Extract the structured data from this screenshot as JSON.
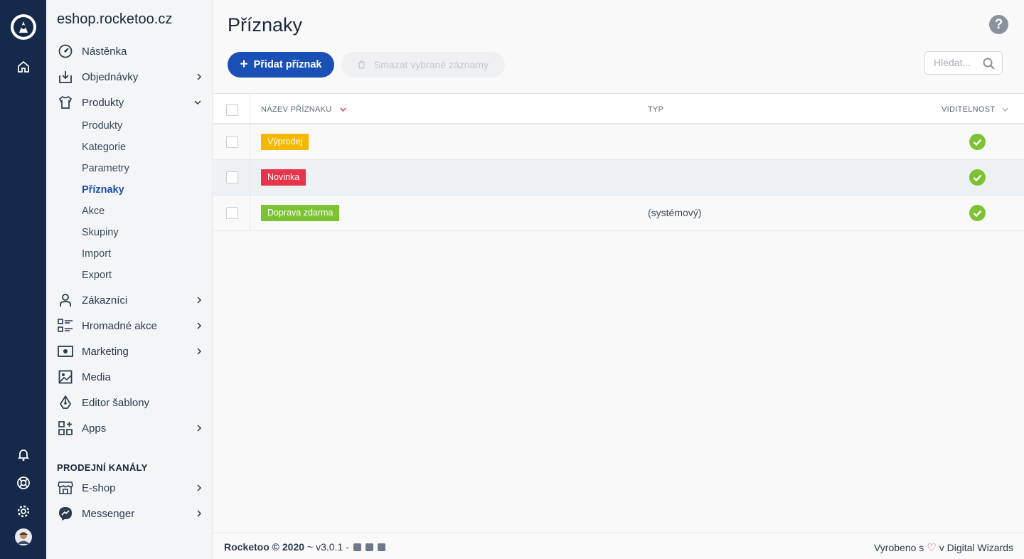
{
  "rail": {
    "icons": [
      "rocketoo-logo-icon",
      "home-icon",
      "bell-icon",
      "lifebuoy-icon",
      "gear-icon",
      "avatar"
    ]
  },
  "sidebar": {
    "shop_name": "eshop.rocketoo.cz",
    "items": [
      {
        "label": "Nástěnka",
        "icon": "dashboard-icon",
        "has_chevron": false
      },
      {
        "label": "Objednávky",
        "icon": "inbox-icon",
        "has_chevron": true
      },
      {
        "label": "Produkty",
        "icon": "shirt-icon",
        "has_chevron": true,
        "expanded": true
      },
      {
        "label": "Zákazníci",
        "icon": "user-icon",
        "has_chevron": true
      },
      {
        "label": "Hromadné akce",
        "icon": "bulk-actions-icon",
        "has_chevron": true
      },
      {
        "label": "Marketing",
        "icon": "money-icon",
        "has_chevron": true
      },
      {
        "label": "Media",
        "icon": "image-icon",
        "has_chevron": false
      },
      {
        "label": "Editor šablony",
        "icon": "pen-tool-icon",
        "has_chevron": false
      },
      {
        "label": "Apps",
        "icon": "apps-icon",
        "has_chevron": true
      }
    ],
    "sub_items": [
      "Produkty",
      "Kategorie",
      "Parametry",
      "Příznaky",
      "Akce",
      "Skupiny",
      "Import",
      "Export"
    ],
    "active_sub": "Příznaky",
    "section_title": "PRODEJNÍ KANÁLY",
    "channels": [
      {
        "label": "E-shop",
        "icon": "store-icon"
      },
      {
        "label": "Messenger",
        "icon": "messenger-icon"
      }
    ]
  },
  "main": {
    "title": "Příznaky",
    "help": "?",
    "add_button": "Přidat příznak",
    "delete_button": "Smazat vybrané záznamy",
    "search_placeholder": "Hledat..."
  },
  "table": {
    "columns": [
      "NÁZEV PŘÍZNAKU",
      "TYP",
      "VIDITELNOST"
    ],
    "rows": [
      {
        "name": "Výprodej",
        "color": "#f5b800",
        "type": "",
        "visible": true
      },
      {
        "name": "Novinka",
        "color": "#e8334a",
        "type": "",
        "visible": true
      },
      {
        "name": "Doprava zdarma",
        "color": "#7cc232",
        "type": "(systémový)",
        "visible": true
      }
    ]
  },
  "footer": {
    "brand": "Rocketoo © 2020",
    "version": "~ v3.0.1 -",
    "made_prefix": "Vyrobeno s",
    "made_suffix": "v Digital Wizards"
  }
}
